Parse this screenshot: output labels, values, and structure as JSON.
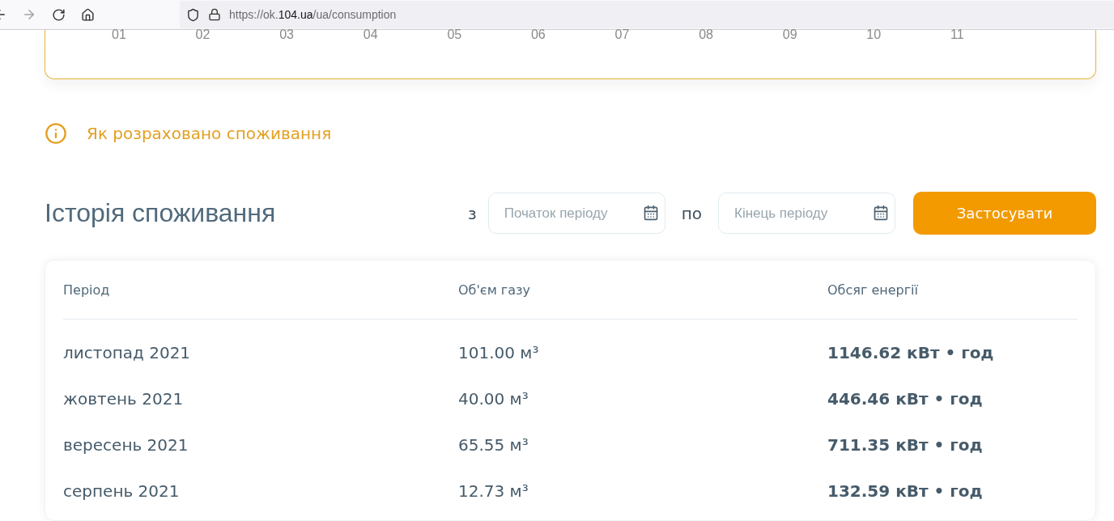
{
  "browser": {
    "url_prefix": "https://ok.",
    "url_host": "104.ua",
    "url_path": "/ua/consumption"
  },
  "chart": {
    "months": [
      "01",
      "02",
      "03",
      "04",
      "05",
      "06",
      "07",
      "08",
      "09",
      "10",
      "11"
    ]
  },
  "info_link": "Як розраховано споживання",
  "history": {
    "title": "Історія споживання",
    "from_label": "з",
    "from_placeholder": "Початок періоду",
    "to_label": "по",
    "to_placeholder": "Кінець періоду",
    "apply_button": "Застосувати"
  },
  "table": {
    "columns": [
      "Період",
      "Об'єм газу",
      "Обсяг енергії"
    ],
    "rows": [
      {
        "period": "листопад 2021",
        "gas": "101.00 м³",
        "energy": "1146.62 кВт • год"
      },
      {
        "period": "жовтень 2021",
        "gas": "40.00 м³",
        "energy": "446.46 кВт • год"
      },
      {
        "period": "вересень 2021",
        "gas": "65.55 м³",
        "energy": "711.35 кВт • год"
      },
      {
        "period": "серпень 2021",
        "gas": "12.73 м³",
        "energy": "132.59 кВт • год"
      }
    ]
  }
}
